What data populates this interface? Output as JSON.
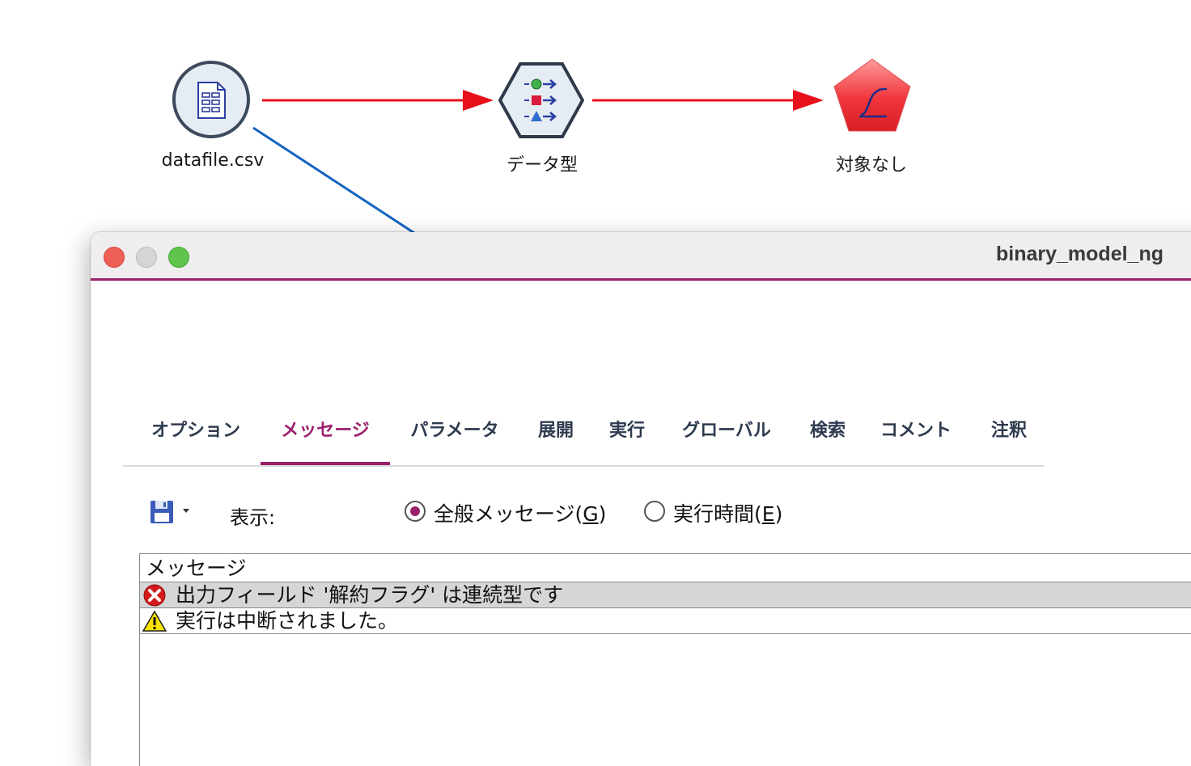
{
  "stream": {
    "nodes": [
      {
        "label": "datafile.csv",
        "type": "source-file"
      },
      {
        "label": "データ型",
        "type": "type-node"
      },
      {
        "label": "対象なし",
        "type": "model-nugget"
      }
    ]
  },
  "dialog": {
    "title": "binary_model_ng",
    "tabs": [
      "オプション",
      "メッセージ",
      "パラメータ",
      "展開",
      "実行",
      "グローバル",
      "検索",
      "コメント",
      "注釈"
    ],
    "active_tab": "メッセージ",
    "toolbar": {
      "show_label": "表示:",
      "radio_general_prefix": "全般メッセージ(",
      "radio_general_key": "G",
      "radio_general_suffix": ")",
      "radio_exec_prefix": "実行時間(",
      "radio_exec_key": "E",
      "radio_exec_suffix": ")",
      "selected": "general"
    },
    "messages": {
      "header": "メッセージ",
      "rows": [
        {
          "icon": "error-icon",
          "text": "出力フィールド '解約フラグ' は連続型です",
          "selected": true
        },
        {
          "icon": "warning-icon",
          "text": "実行は中断されました。",
          "selected": false
        }
      ]
    }
  },
  "colors": {
    "accent": "#9c1f6b",
    "flow_arrow": "#e8101a",
    "link_line": "#1565c0"
  }
}
